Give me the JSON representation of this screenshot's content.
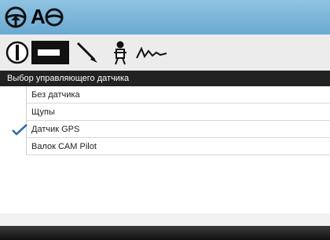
{
  "topbar": {
    "icons": [
      "steering-wheel-icon",
      "auto-steer-icon"
    ],
    "auto_label": "A"
  },
  "toolbar": {
    "icons": [
      "machine-setup-icon",
      "implement-icon",
      "probe-icon",
      "operator-icon",
      "sensor-wave-icon"
    ]
  },
  "menu": {
    "title": "Выбор управляющего датчика",
    "items": [
      {
        "label": "Без датчика",
        "selected": false
      },
      {
        "label": "Щупы",
        "selected": false
      },
      {
        "label": "Датчик GPS",
        "selected": true
      },
      {
        "label": "Валок CAM Pilot",
        "selected": false
      }
    ]
  },
  "colors": {
    "topbar": "#7bb6db",
    "header": "#222222",
    "check": "#2f6ea9"
  }
}
